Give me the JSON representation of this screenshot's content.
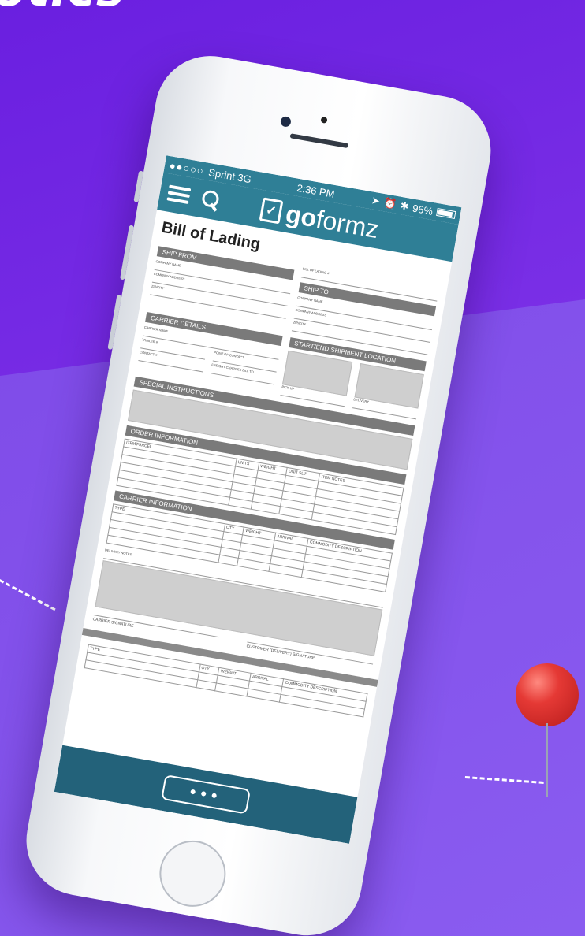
{
  "hero_text": "otics",
  "status_bar": {
    "signal": "●●○○○",
    "carrier": "Sprint 3G",
    "time": "2:36 PM",
    "battery": "96%",
    "icons": [
      "location-icon",
      "alarm-icon",
      "bluetooth-icon"
    ]
  },
  "app": {
    "logo_go": "go",
    "logo_rest": "formz"
  },
  "form": {
    "title": "Bill of Lading",
    "ship_from": {
      "heading": "SHIP FROM",
      "company_name": "COMPANY NAME",
      "company_address": "COMPANY ADDRESS",
      "zip_city": "ZIP/CITY"
    },
    "ship_to": {
      "heading": "SHIP TO",
      "bol_number": "BILL OF LADING #",
      "company_name": "COMPANY NAME",
      "company_address": "COMPANY ADDRESS",
      "zip_city": "ZIP/CITY"
    },
    "carrier_details": {
      "heading": "CARRIER DETAILS",
      "carrier_name": "CARRIER NAME",
      "trailer": "TRAILER #",
      "point_of_contact": "POINT OF CONTACT",
      "contact": "CONTACT #",
      "freight_bill_to": "FREIGHT CHARGES BILL TO"
    },
    "location": {
      "heading": "START/END SHIPMENT LOCATION",
      "pickup": "PICK UP",
      "delivery": "DELIVERY"
    },
    "special_instructions": {
      "heading": "SPECIAL INSTRUCTIONS"
    },
    "order_information": {
      "heading": "ORDER INFORMATION",
      "columns": [
        "ITEM/PARCEL",
        "UNITS",
        "WEIGHT",
        "UNIT SLIP",
        "ITEM NOTES"
      ]
    },
    "carrier_information": {
      "heading": "CARRIER INFORMATION",
      "columns": [
        "TYPE",
        "QTY",
        "WEIGHT",
        "ARRIVAL",
        "COMMODITY DESCRIPTION"
      ]
    },
    "delivery_notes": "DELIVERY NOTES",
    "carrier_signature": "CARRIER SIGNATURE",
    "customer_signature": "CUSTOMER (DELIVERY) SIGNATURE",
    "second_table": {
      "columns": [
        "TYPE",
        "QTY",
        "WEIGHT",
        "ARRIVAL",
        "COMMODITY DESCRIPTION"
      ]
    }
  },
  "bottom": {
    "more_label": "•••"
  },
  "colors": {
    "brand": "#2f7f96",
    "background": "#7a2fe6",
    "pin": "#e53935"
  }
}
